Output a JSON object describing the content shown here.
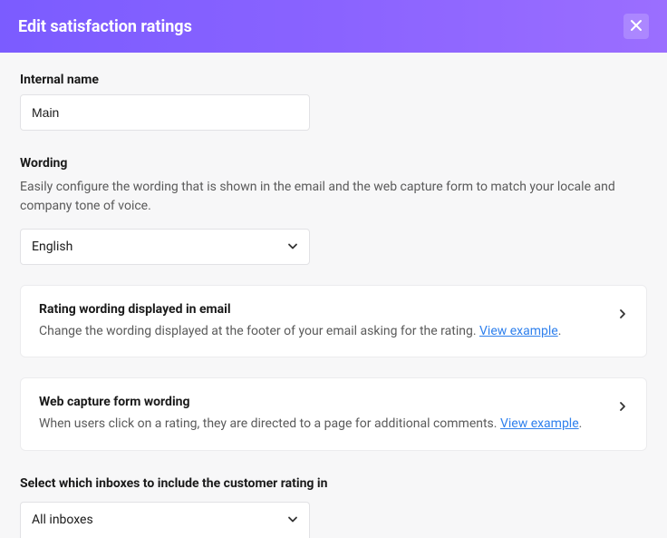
{
  "header": {
    "title": "Edit satisfaction ratings"
  },
  "internal_name": {
    "label": "Internal name",
    "value": "Main"
  },
  "wording": {
    "label": "Wording",
    "description": "Easily configure the wording that is shown in the email and the web capture form to match your locale and company tone of voice.",
    "select_value": "English"
  },
  "card_email": {
    "title": "Rating wording displayed in email",
    "desc": "Change the wording displayed at the footer of your email asking for the rating. ",
    "link": "View example"
  },
  "card_web": {
    "title": "Web capture form wording",
    "desc": "When users click on a rating, they are directed to a page for additional comments. ",
    "link": "View example"
  },
  "inboxes": {
    "label": "Select which inboxes to include the customer rating in",
    "select_value": "All inboxes"
  }
}
